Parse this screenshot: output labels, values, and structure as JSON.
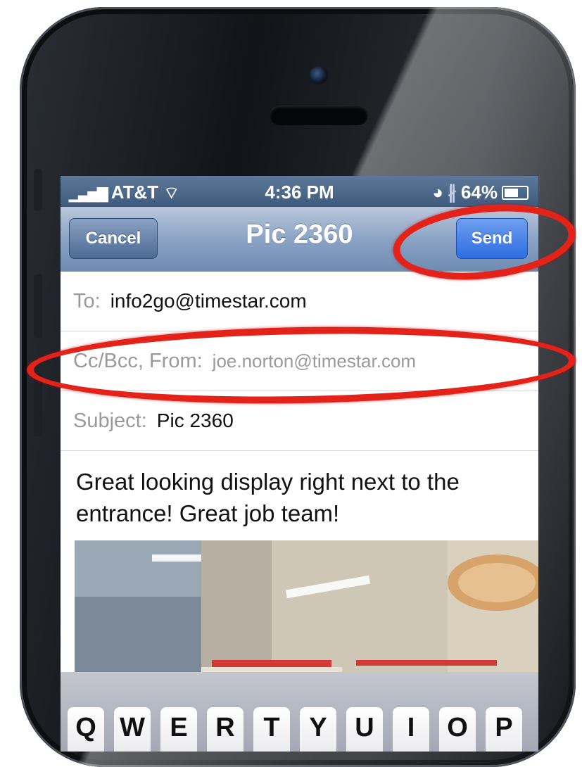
{
  "status_bar": {
    "carrier": "AT&T",
    "time": "4:36 PM",
    "battery": "64%",
    "battery_level": 0.64
  },
  "nav": {
    "cancel_label": "Cancel",
    "title": "Pic 2360",
    "send_label": "Send"
  },
  "fields": {
    "to_label": "To:",
    "to_value": "info2go@timestar.com",
    "cc_label": "Cc/Bcc, From:",
    "cc_value": "joe.norton@timestar.com",
    "subject_label": "Subject:",
    "subject_value": "Pic 2360"
  },
  "message_body": "Great looking display right next to the entrance!  Great job team!",
  "keyboard": {
    "top_row": [
      "Q",
      "W",
      "E",
      "R",
      "T",
      "Y",
      "U",
      "I",
      "O",
      "P"
    ]
  },
  "colors": {
    "annotation": "#e32219",
    "send": "#2e6ce0",
    "navbar": "#8ba3c4"
  },
  "icons": [
    "signal-icon",
    "wifi-icon",
    "alarm-icon",
    "bluetooth-icon",
    "battery-icon"
  ]
}
